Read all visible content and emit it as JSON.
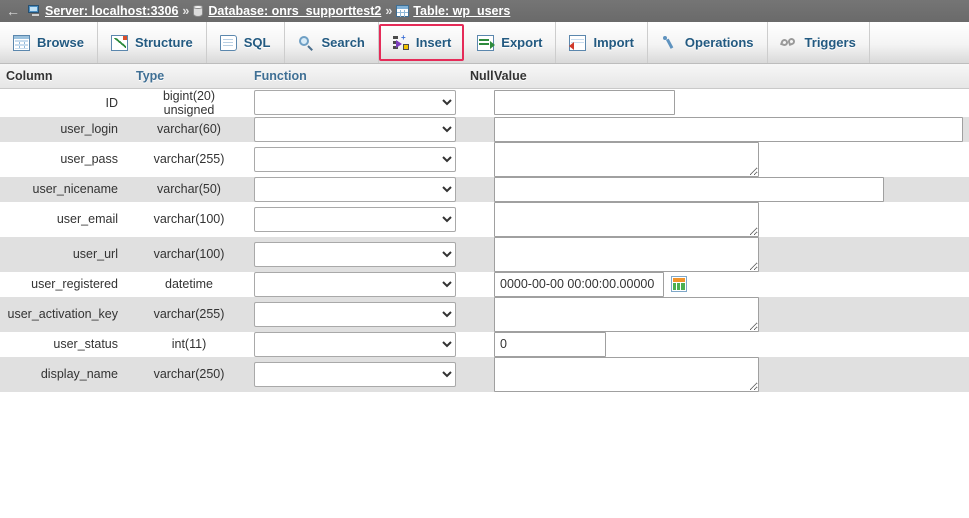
{
  "breadcrumb": {
    "back_arrow": "←",
    "separator": "»",
    "server_icon": "server-icon",
    "server_label": "Server: localhost:3306",
    "database_icon": "database-icon",
    "database_label": "Database: onrs_supporttest2",
    "table_icon": "table-icon",
    "table_label": "Table: wp_users"
  },
  "tabs": [
    {
      "label": "Browse",
      "icon": "browse-icon",
      "active": false
    },
    {
      "label": "Structure",
      "icon": "structure-icon",
      "active": false
    },
    {
      "label": "SQL",
      "icon": "sql-icon",
      "active": false
    },
    {
      "label": "Search",
      "icon": "search-icon",
      "active": false
    },
    {
      "label": "Insert",
      "icon": "insert-icon",
      "active": true
    },
    {
      "label": "Export",
      "icon": "export-icon",
      "active": false
    },
    {
      "label": "Import",
      "icon": "import-icon",
      "active": false
    },
    {
      "label": "Operations",
      "icon": "operations-icon",
      "active": false
    },
    {
      "label": "Triggers",
      "icon": "triggers-icon",
      "active": false
    }
  ],
  "table": {
    "headers": {
      "column": "Column",
      "type": "Type",
      "function": "Function",
      "null": "Null",
      "value": "Value"
    },
    "rows": [
      {
        "column": "ID",
        "type": "bigint(20) unsigned",
        "function": "",
        "null": "",
        "value": "",
        "value_kind": "input",
        "width_class": "w-id",
        "has_calendar": false
      },
      {
        "column": "user_login",
        "type": "varchar(60)",
        "function": "",
        "null": "",
        "value": "",
        "value_kind": "input",
        "width_class": "w-wide",
        "has_calendar": false
      },
      {
        "column": "user_pass",
        "type": "varchar(255)",
        "function": "",
        "null": "",
        "value": "",
        "value_kind": "textarea",
        "width_class": "w-textarea",
        "has_calendar": false
      },
      {
        "column": "user_nicename",
        "type": "varchar(50)",
        "function": "",
        "null": "",
        "value": "",
        "value_kind": "input",
        "width_class": "w-nicename",
        "has_calendar": false
      },
      {
        "column": "user_email",
        "type": "varchar(100)",
        "function": "",
        "null": "",
        "value": "",
        "value_kind": "textarea",
        "width_class": "w-textarea",
        "has_calendar": false
      },
      {
        "column": "user_url",
        "type": "varchar(100)",
        "function": "",
        "null": "",
        "value": "",
        "value_kind": "textarea",
        "width_class": "w-textarea",
        "has_calendar": false
      },
      {
        "column": "user_registered",
        "type": "datetime",
        "function": "",
        "null": "",
        "value": "0000-00-00 00:00:00.00000",
        "value_kind": "input",
        "width_class": "w-datetime",
        "has_calendar": true
      },
      {
        "column": "user_activation_key",
        "type": "varchar(255)",
        "function": "",
        "null": "",
        "value": "",
        "value_kind": "textarea",
        "width_class": "w-textarea",
        "has_calendar": false
      },
      {
        "column": "user_status",
        "type": "int(11)",
        "function": "",
        "null": "",
        "value": "0",
        "value_kind": "input",
        "width_class": "w-status",
        "has_calendar": false
      },
      {
        "column": "display_name",
        "type": "varchar(250)",
        "function": "",
        "null": "",
        "value": "",
        "value_kind": "textarea",
        "width_class": "w-textarea",
        "has_calendar": false
      }
    ]
  },
  "colors": {
    "breadcrumb_bg": "#6e6e6e",
    "tab_link": "#235a81",
    "active_tab_border": "#e52b58",
    "row_even_bg": "#e0e0e0",
    "row_odd_bg": "#ffffff"
  }
}
